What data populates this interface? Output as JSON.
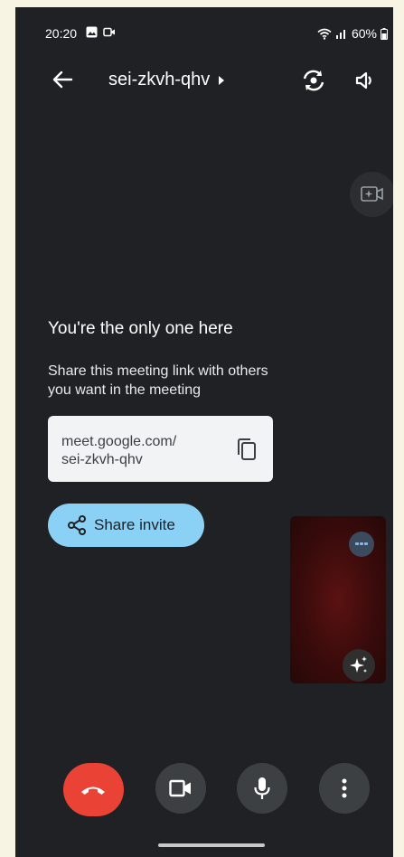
{
  "status_bar": {
    "time": "20:20",
    "battery": "60%"
  },
  "top_bar": {
    "meeting_code": "sei-zkvh-qhv"
  },
  "empty_state": {
    "title": "You're the only one here",
    "subtitle": "Share this meeting link with others you want in the meeting",
    "link_line1": "meet.google.com/",
    "link_line2": "sei-zkvh-qhv"
  },
  "share_button": {
    "label": "Share invite"
  },
  "colors": {
    "background": "#202124",
    "share_button": "#8ad1f5",
    "hangup": "#ea4335",
    "control_button": "#3c4043"
  },
  "icons": [
    "back-arrow-icon",
    "play-arrow-icon",
    "switch-camera-icon",
    "speaker-icon",
    "effects-icon",
    "copy-icon",
    "share-icon",
    "more-horiz-icon",
    "sparkle-icon",
    "hang-up-icon",
    "video-camera-icon",
    "microphone-icon",
    "more-vert-icon"
  ]
}
